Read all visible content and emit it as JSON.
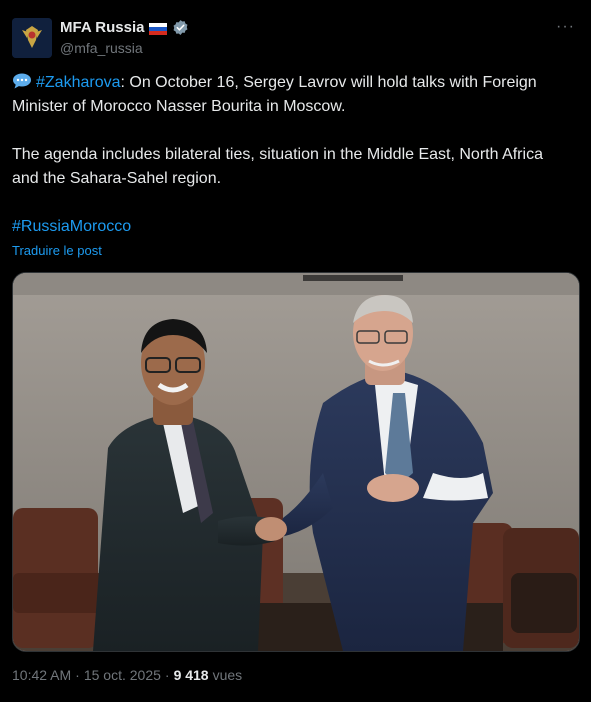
{
  "account": {
    "display_name": "MFA Russia",
    "handle": "@mfa_russia",
    "verified_color": "#1d9bf0",
    "flag": "russia-flag"
  },
  "menu": {
    "more_label": "···"
  },
  "post": {
    "hashtag_author": "#Zakharova",
    "line1_rest": ": On October 16, Sergey Lavrov will hold talks with Foreign Minister of Morocco Nasser Bourita in Moscow.",
    "paragraph2": "The agenda includes bilateral ties, situation in the Middle East, North Africa and the Sahara-Sahel region.",
    "hashtag_tag": "#RussiaMorocco",
    "translate_label": "Traduire le post"
  },
  "meta": {
    "time": "10:42 AM",
    "separator1": "·",
    "date": "15 oct. 2025",
    "separator2": "·",
    "views_count": "9 418",
    "views_label": "vues"
  },
  "colors": {
    "background": "#000000",
    "text": "#e7e9ea",
    "muted": "#71767b",
    "link": "#1d9bf0"
  }
}
